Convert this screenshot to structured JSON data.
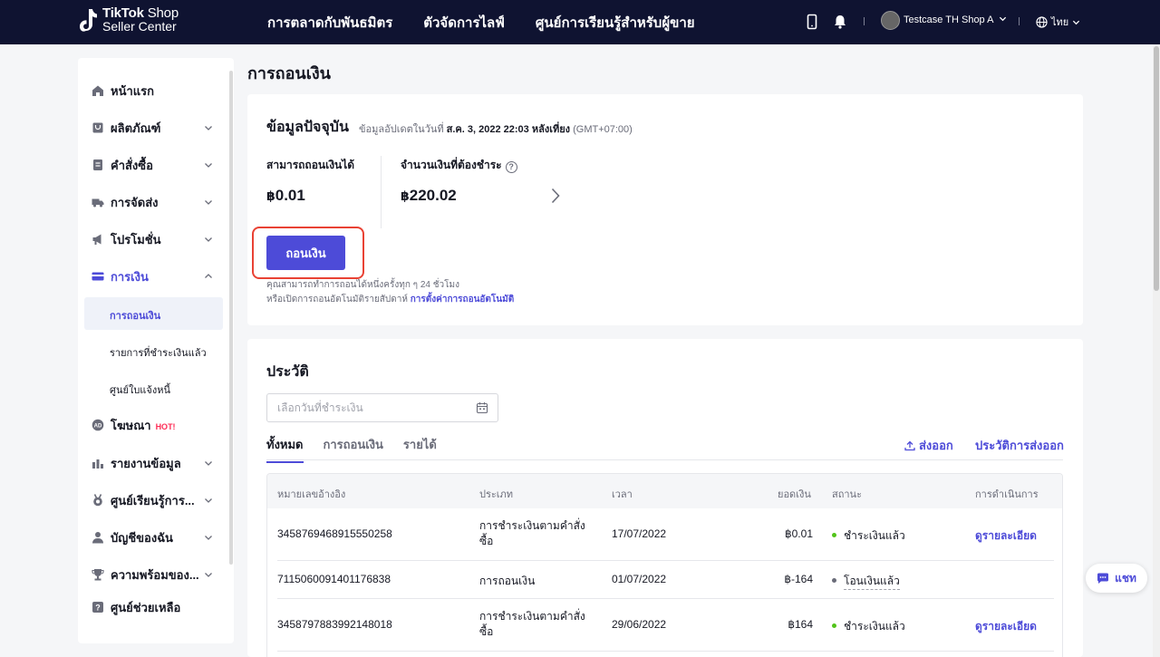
{
  "header": {
    "logo_line1": "TikTok",
    "logo_line1_b": "Shop",
    "logo_line2": "Seller Center",
    "nav": [
      "การตลาดกับพันธมิตร",
      "ตัวจัดการไลฟ์",
      "ศูนย์การเรียนรู้สำหรับผู้ขาย"
    ],
    "shop_name": "Testcase TH Shop A",
    "language": "ไทย"
  },
  "sidebar": {
    "items": [
      {
        "label": "หน้าแรก",
        "icon": "home-icon"
      },
      {
        "label": "ผลิตภัณฑ์",
        "icon": "product-icon"
      },
      {
        "label": "คำสั่งซื้อ",
        "icon": "order-icon"
      },
      {
        "label": "การจัดส่ง",
        "icon": "truck-icon"
      },
      {
        "label": "โปรโมชั่น",
        "icon": "megaphone-icon"
      },
      {
        "label": "การเงิน",
        "icon": "card-icon"
      },
      {
        "label": "โฆษณา",
        "icon": "ad-icon",
        "badge": "HOT!"
      },
      {
        "label": "รายงานข้อมูล",
        "icon": "chart-icon"
      },
      {
        "label": "ศูนย์เรียนรู้การ...",
        "icon": "medal-icon"
      },
      {
        "label": "บัญชีของฉัน",
        "icon": "user-icon"
      },
      {
        "label": "ความพร้อมของ...",
        "icon": "trophy-icon"
      },
      {
        "label": "ศูนย์ช่วยเหลือ",
        "icon": "help-icon"
      }
    ],
    "finance_sub": [
      "การถอนเงิน",
      "รายการที่ชำระเงินแล้ว",
      "ศูนย์ใบแจ้งหนี้"
    ]
  },
  "page": {
    "title": "การถอนเงิน"
  },
  "current": {
    "title": "ข้อมูลปัจจุบัน",
    "updated_prefix": "ข้อมูลอัปเดตในวันที่",
    "updated_date": "ส.ค. 3, 2022 22:03 หลังเที่ยง",
    "updated_tz": "(GMT+07:00)",
    "withdrawable_label": "สามารถถอนเงินได้",
    "withdrawable_currency": "฿",
    "withdrawable_value": "0.01",
    "payable_label": "จำนวนเงินที่ต้องชำระ",
    "payable_currency": "฿",
    "payable_value": "220.02",
    "withdraw_button": "ถอนเงิน",
    "note_line1": "คุณสามารถทำการถอนได้หนึ่งครั้งทุก ๆ 24 ชั่วโมง",
    "note_line2": "หรือเปิดการถอนอัตโนมัติรายสัปดาห์",
    "note_link": "การตั้งค่าการถอนอัตโนมัติ"
  },
  "history": {
    "title": "ประวัติ",
    "date_placeholder": "เลือกวันที่ชำระเงิน",
    "tabs": [
      "ทั้งหมด",
      "การถอนเงิน",
      "รายได้"
    ],
    "export": "ส่งออก",
    "export_history": "ประวัติการส่งออก",
    "columns": [
      "หมายเลขอ้างอิง",
      "ประเภท",
      "เวลา",
      "ยอดเงิน",
      "สถานะ",
      "การดำเนินการ"
    ],
    "rows": [
      {
        "ref": "3458769468915550258",
        "type": "การชำระเงินตามคำสั่งซื้อ",
        "time": "17/07/2022",
        "amount": "฿0.01",
        "status": "ชำระเงินแล้ว",
        "status_color": "#52c41a",
        "action": "ดูรายละเอียด"
      },
      {
        "ref": "7115060091401176838",
        "type": "การถอนเงิน",
        "time": "01/07/2022",
        "amount": "฿-164",
        "status": "โอนเงินแล้ว",
        "status_color": "#6a6c79",
        "action": ""
      },
      {
        "ref": "3458797883992148018",
        "type": "การชำระเงินตามคำสั่งซื้อ",
        "time": "29/06/2022",
        "amount": "฿164",
        "status": "ชำระเงินแล้ว",
        "status_color": "#52c41a",
        "action": "ดูรายละเอียด"
      }
    ]
  },
  "chat": {
    "label": "แชท"
  },
  "colors": {
    "brand": "#4d4bd8",
    "topbar": "#0f1331",
    "highlight": "#e94234"
  }
}
